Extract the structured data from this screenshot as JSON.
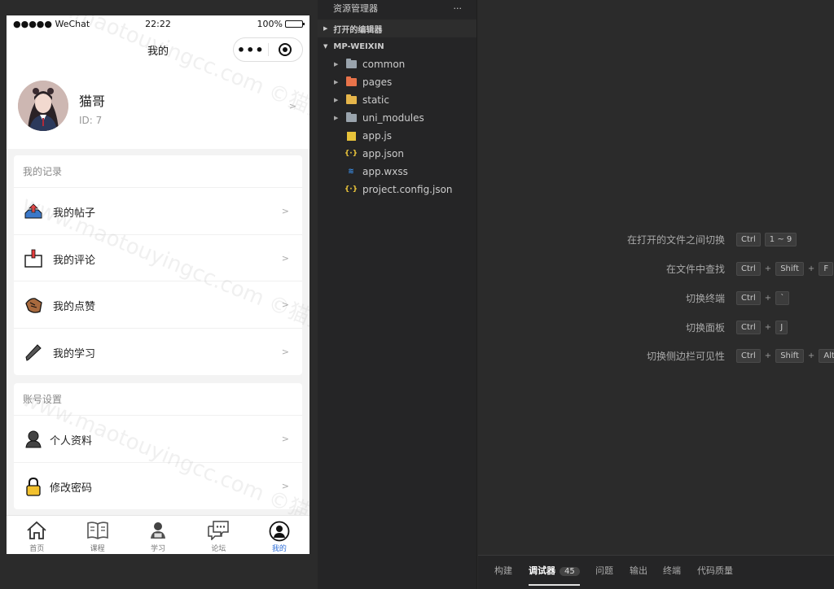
{
  "statusbar": {
    "carrier": "●●●●● WeChat",
    "time": "22:22",
    "battery": "100%"
  },
  "navbar": {
    "title": "我的"
  },
  "profile": {
    "name": "猫哥",
    "id_text": "ID: 7"
  },
  "records": {
    "title": "我的记录",
    "items": [
      {
        "label": "我的帖子",
        "icon": "upload-tray-icon"
      },
      {
        "label": "我的评论",
        "icon": "comment-box-icon"
      },
      {
        "label": "我的点赞",
        "icon": "thumbs-up-icon"
      },
      {
        "label": "我的学习",
        "icon": "pencil-icon"
      }
    ]
  },
  "account": {
    "title": "账号设置",
    "items": [
      {
        "label": "个人资料",
        "icon": "user-profile-icon"
      },
      {
        "label": "修改密码",
        "icon": "padlock-icon"
      }
    ]
  },
  "tabbar": [
    {
      "label": "首页",
      "icon": "home-icon"
    },
    {
      "label": "课程",
      "icon": "book-icon"
    },
    {
      "label": "学习",
      "icon": "student-icon"
    },
    {
      "label": "论坛",
      "icon": "chat-bubble-icon"
    },
    {
      "label": "我的",
      "icon": "user-circle-icon",
      "active": true
    }
  ],
  "watermark": "www.maotouyingcc.com  ©猫头鹰源码",
  "explorer": {
    "title": "资源管理器",
    "more": "···",
    "sections": [
      "打开的编辑器",
      "MP-WEIXIN"
    ],
    "tree": [
      {
        "name": "common",
        "type": "folder",
        "color": "#9aa4ad"
      },
      {
        "name": "pages",
        "type": "folder",
        "color": "#e8734a"
      },
      {
        "name": "static",
        "type": "folder",
        "color": "#e5b54a"
      },
      {
        "name": "uni_modules",
        "type": "folder",
        "color": "#9aa4ad"
      },
      {
        "name": "app.js",
        "type": "js"
      },
      {
        "name": "app.json",
        "type": "json"
      },
      {
        "name": "app.wxss",
        "type": "css"
      },
      {
        "name": "project.config.json",
        "type": "json"
      }
    ]
  },
  "shortcuts": [
    {
      "label": "在打开的文件之间切换",
      "keys": [
        "Ctrl",
        "1 ~ 9"
      ]
    },
    {
      "label": "在文件中查找",
      "keys": [
        "Ctrl",
        "+",
        "Shift",
        "+",
        "F"
      ]
    },
    {
      "label": "切换终端",
      "keys": [
        "Ctrl",
        "+",
        "`"
      ]
    },
    {
      "label": "切换面板",
      "keys": [
        "Ctrl",
        "+",
        "J"
      ]
    },
    {
      "label": "切换侧边栏可见性",
      "keys": [
        "Ctrl",
        "+",
        "Shift",
        "+",
        "Alt"
      ]
    }
  ],
  "bottom_panel": {
    "tabs": [
      "构建",
      "调试器",
      "问题",
      "输出",
      "终端",
      "代码质量"
    ],
    "active": 1,
    "debugger_badge": "45"
  }
}
